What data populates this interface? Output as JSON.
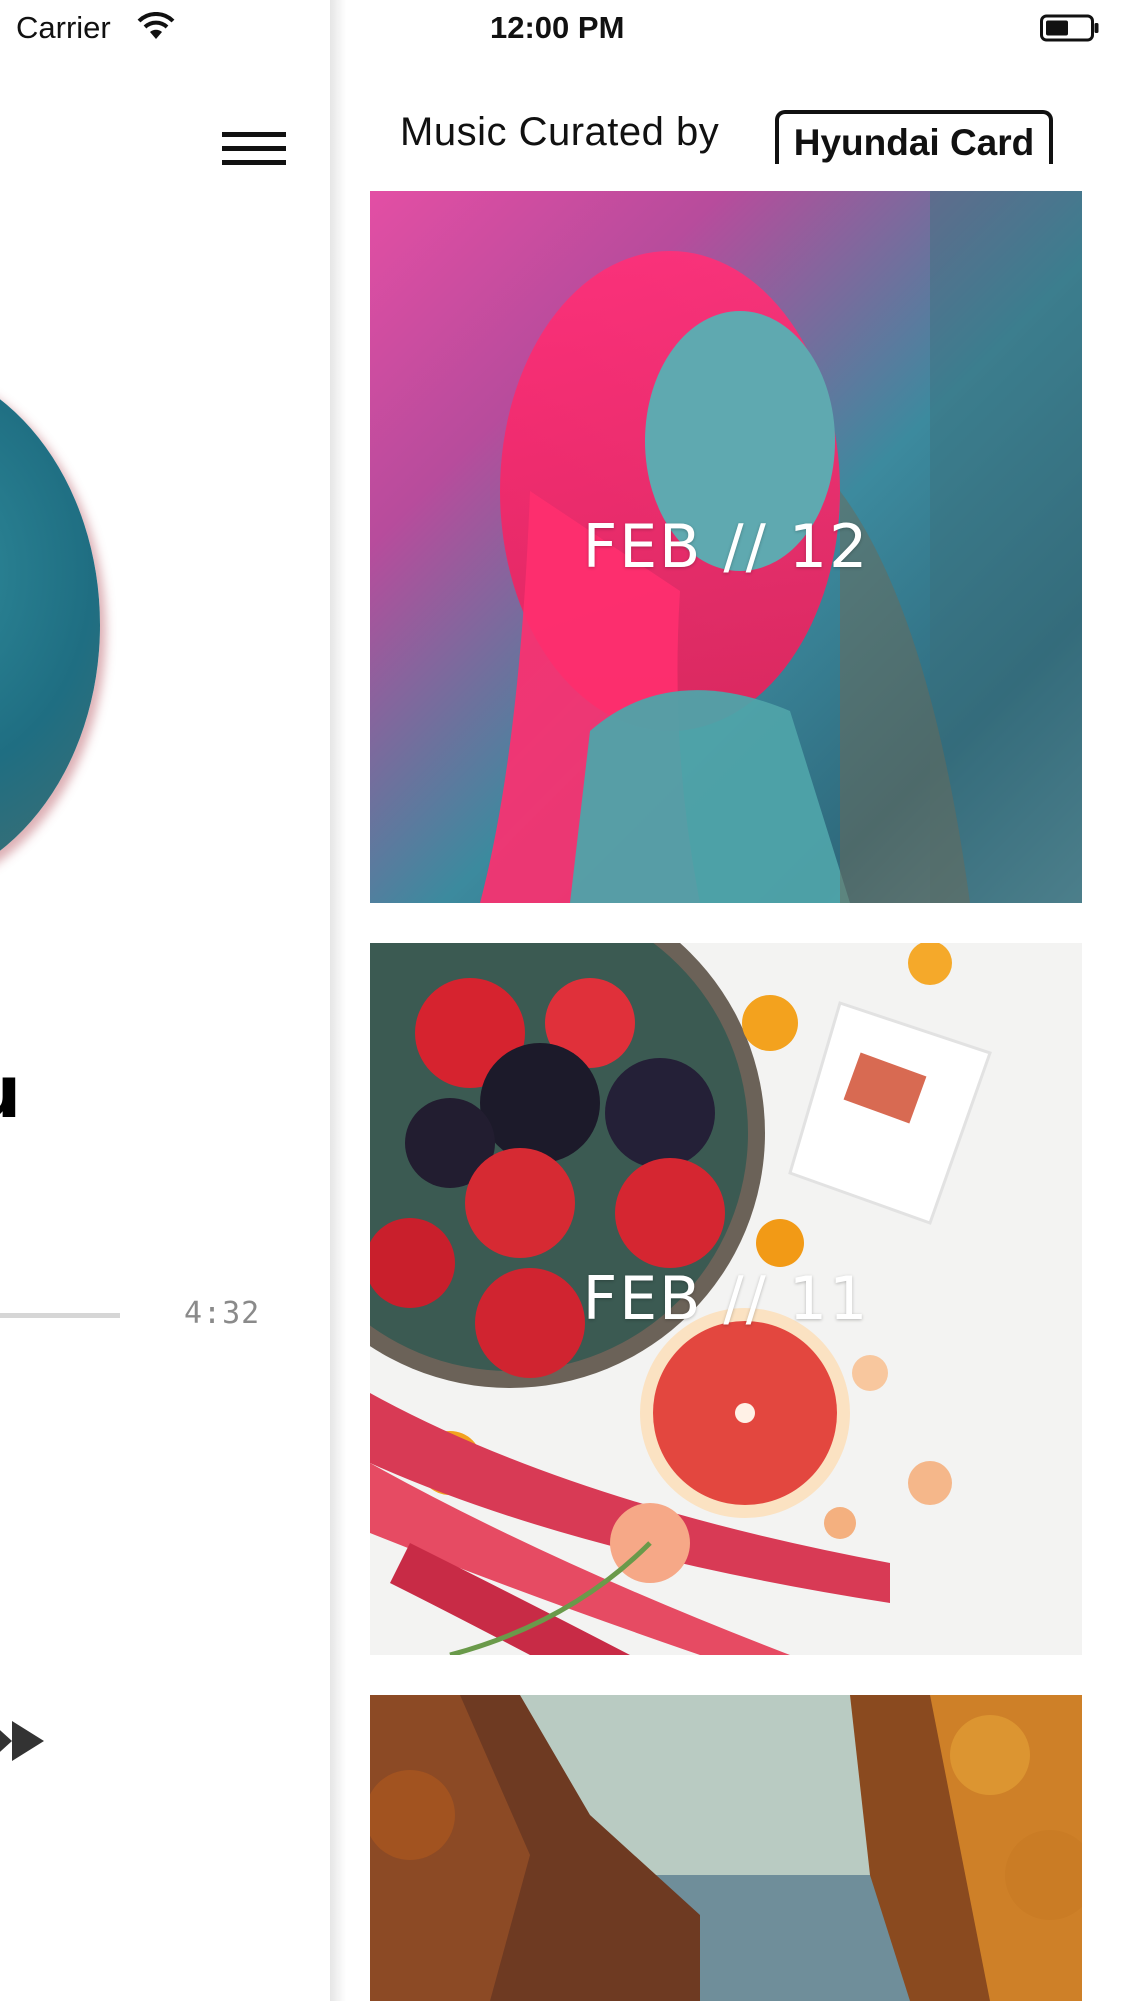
{
  "status_bar": {
    "carrier": "Carrier",
    "time": "12:00 PM"
  },
  "player": {
    "title_glyph": "u",
    "duration": "4:32"
  },
  "feed": {
    "header_prefix": "Music Curated by",
    "brand": "Hyundai Card",
    "cards": [
      {
        "label": "FEB // 12"
      },
      {
        "label": "FEB // 11"
      },
      {
        "label": ""
      }
    ]
  },
  "icons": {
    "wifi": "wifi-icon",
    "battery": "battery-icon",
    "menu": "hamburger-menu-icon",
    "fast_forward": "fast-forward-icon"
  }
}
